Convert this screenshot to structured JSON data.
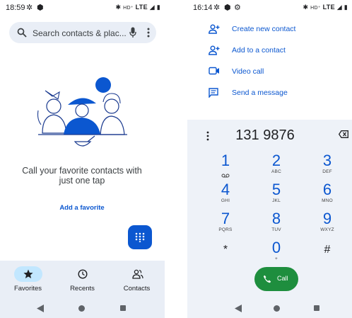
{
  "left": {
    "status": {
      "time": "18:59",
      "network": "LTE"
    },
    "search": {
      "placeholder": "Search contacts & plac..."
    },
    "empty_message": "Call your favorite contacts with just one tap",
    "add_favorite": "Add a favorite",
    "nav": [
      {
        "label": "Favorites",
        "icon": "star-icon",
        "active": true
      },
      {
        "label": "Recents",
        "icon": "clock-icon",
        "active": false
      },
      {
        "label": "Contacts",
        "icon": "people-icon",
        "active": false
      }
    ]
  },
  "right": {
    "status": {
      "time": "16:14",
      "network": "LTE"
    },
    "actions": [
      {
        "label": "Create new contact",
        "icon": "person-add-icon"
      },
      {
        "label": "Add to a contact",
        "icon": "person-add-icon"
      },
      {
        "label": "Video call",
        "icon": "videocam-icon"
      },
      {
        "label": "Send a message",
        "icon": "message-icon"
      }
    ],
    "dialed_number": "131 9876",
    "keys": [
      {
        "digit": "1",
        "sub": "voicemail"
      },
      {
        "digit": "2",
        "sub": "ABC"
      },
      {
        "digit": "3",
        "sub": "DEF"
      },
      {
        "digit": "4",
        "sub": "GHI"
      },
      {
        "digit": "5",
        "sub": "JKL"
      },
      {
        "digit": "6",
        "sub": "MNO"
      },
      {
        "digit": "7",
        "sub": "PQRS"
      },
      {
        "digit": "8",
        "sub": "TUV"
      },
      {
        "digit": "9",
        "sub": "WXYZ"
      },
      {
        "digit": "*",
        "sub": ""
      },
      {
        "digit": "0",
        "sub": "+"
      },
      {
        "digit": "#",
        "sub": ""
      }
    ],
    "call_label": "Call"
  },
  "colors": {
    "accent": "#0b57d0",
    "call_green": "#1e8e3e",
    "nav_bg": "#e9eef6",
    "active_pill": "#c2e7ff"
  }
}
